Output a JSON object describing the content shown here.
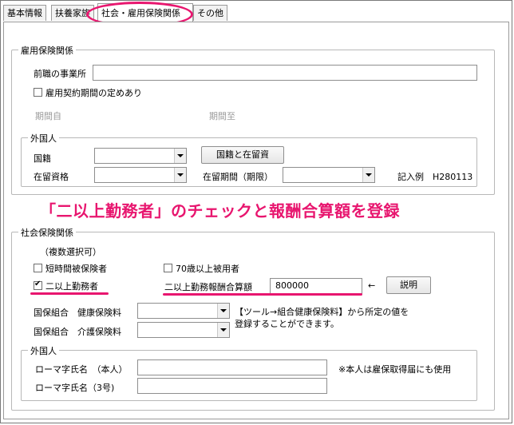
{
  "tabs": [
    {
      "label": "基本情報"
    },
    {
      "label": "扶養家族"
    },
    {
      "label": "社会・雇用保険関係"
    },
    {
      "label": "その他"
    }
  ],
  "employment": {
    "group_label": "雇用保険関係",
    "prev_employer_label": "前職の事業所",
    "prev_employer_value": "",
    "contract_period_label": "雇用契約期間の定めあり",
    "contract_period_checked": false,
    "period_from_label": "期間自",
    "period_to_label": "期間至",
    "foreigner": {
      "group_label": "外国人",
      "nationality_label": "国籍",
      "nationality_value": "",
      "nationality_button": "国籍と在留資",
      "status_label": "在留資格",
      "status_value": "",
      "stay_period_label": "在留期間（期限）",
      "stay_period_value": "",
      "example": "記入例　H280113"
    }
  },
  "annotation": {
    "banner": "「二以上勤務者」のチェックと報酬合算額を登録",
    "accent_color": "#e8166f"
  },
  "social": {
    "group_label": "社会保険関係",
    "multi_select_note": "（複数選択可）",
    "short_time_label": "短時間被保険者",
    "short_time_checked": false,
    "over70_label": "70歳以上被用者",
    "over70_checked": false,
    "multi_work_label": "二以上勤務者",
    "multi_work_checked": true,
    "combined_pay_label": "二以上勤務報酬合算額",
    "combined_pay_value": "800000",
    "arrow": "←",
    "explain_button": "説明",
    "health_label": "国保組合　健康保険料",
    "health_value": "",
    "care_label": "国保組合　介護保険料",
    "care_value": "",
    "note_line1": "【ツール→組合健康保険料】から所定の値を",
    "note_line2": "登録することができます。",
    "foreigner": {
      "group_label": "外国人",
      "roman_name_label": "ローマ字氏名　（本人）",
      "roman_name_value": "",
      "roman_name_note": "※本人は雇保取得届にも使用",
      "roman_name3_label": "ローマ字氏名（3号)",
      "roman_name3_value": ""
    }
  }
}
